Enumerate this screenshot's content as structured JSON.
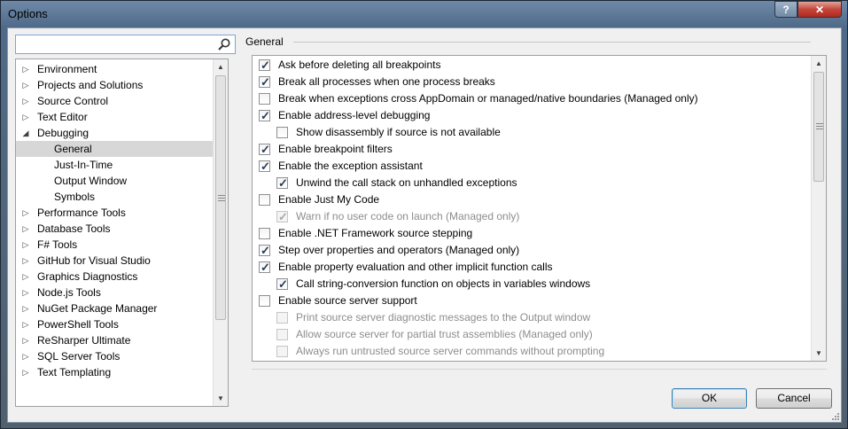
{
  "window": {
    "title": "Options",
    "help_label": "?",
    "close_label": "✕"
  },
  "search": {
    "value": "",
    "placeholder": ""
  },
  "tree": {
    "items": [
      {
        "label": "Environment",
        "expander": "collapsed",
        "level": 0,
        "selected": false
      },
      {
        "label": "Projects and Solutions",
        "expander": "collapsed",
        "level": 0,
        "selected": false
      },
      {
        "label": "Source Control",
        "expander": "collapsed",
        "level": 0,
        "selected": false
      },
      {
        "label": "Text Editor",
        "expander": "collapsed",
        "level": 0,
        "selected": false
      },
      {
        "label": "Debugging",
        "expander": "expanded",
        "level": 0,
        "selected": false
      },
      {
        "label": "General",
        "expander": "none",
        "level": 1,
        "selected": true
      },
      {
        "label": "Just-In-Time",
        "expander": "none",
        "level": 1,
        "selected": false
      },
      {
        "label": "Output Window",
        "expander": "none",
        "level": 1,
        "selected": false
      },
      {
        "label": "Symbols",
        "expander": "none",
        "level": 1,
        "selected": false
      },
      {
        "label": "Performance Tools",
        "expander": "collapsed",
        "level": 0,
        "selected": false
      },
      {
        "label": "Database Tools",
        "expander": "collapsed",
        "level": 0,
        "selected": false
      },
      {
        "label": "F# Tools",
        "expander": "collapsed",
        "level": 0,
        "selected": false
      },
      {
        "label": "GitHub for Visual Studio",
        "expander": "collapsed",
        "level": 0,
        "selected": false
      },
      {
        "label": "Graphics Diagnostics",
        "expander": "collapsed",
        "level": 0,
        "selected": false
      },
      {
        "label": "Node.js Tools",
        "expander": "collapsed",
        "level": 0,
        "selected": false
      },
      {
        "label": "NuGet Package Manager",
        "expander": "collapsed",
        "level": 0,
        "selected": false
      },
      {
        "label": "PowerShell Tools",
        "expander": "collapsed",
        "level": 0,
        "selected": false
      },
      {
        "label": "ReSharper Ultimate",
        "expander": "collapsed",
        "level": 0,
        "selected": false
      },
      {
        "label": "SQL Server Tools",
        "expander": "collapsed",
        "level": 0,
        "selected": false
      },
      {
        "label": "Text Templating",
        "expander": "collapsed",
        "level": 0,
        "selected": false
      }
    ]
  },
  "section": {
    "title": "General"
  },
  "options": [
    {
      "label": "Ask before deleting all breakpoints",
      "checked": true,
      "enabled": true,
      "indent": 0
    },
    {
      "label": "Break all processes when one process breaks",
      "checked": true,
      "enabled": true,
      "indent": 0
    },
    {
      "label": "Break when exceptions cross AppDomain or managed/native boundaries (Managed only)",
      "checked": false,
      "enabled": true,
      "indent": 0
    },
    {
      "label": "Enable address-level debugging",
      "checked": true,
      "enabled": true,
      "indent": 0
    },
    {
      "label": "Show disassembly if source is not available",
      "checked": false,
      "enabled": true,
      "indent": 1
    },
    {
      "label": "Enable breakpoint filters",
      "checked": true,
      "enabled": true,
      "indent": 0
    },
    {
      "label": "Enable the exception assistant",
      "checked": true,
      "enabled": true,
      "indent": 0
    },
    {
      "label": "Unwind the call stack on unhandled exceptions",
      "checked": true,
      "enabled": true,
      "indent": 1
    },
    {
      "label": "Enable Just My Code",
      "checked": false,
      "enabled": true,
      "indent": 0
    },
    {
      "label": "Warn if no user code on launch (Managed only)",
      "checked": true,
      "enabled": false,
      "indent": 1
    },
    {
      "label": "Enable .NET Framework source stepping",
      "checked": false,
      "enabled": true,
      "indent": 0
    },
    {
      "label": "Step over properties and operators (Managed only)",
      "checked": true,
      "enabled": true,
      "indent": 0
    },
    {
      "label": "Enable property evaluation and other implicit function calls",
      "checked": true,
      "enabled": true,
      "indent": 0
    },
    {
      "label": "Call string-conversion function on objects in variables windows",
      "checked": true,
      "enabled": true,
      "indent": 1
    },
    {
      "label": "Enable source server support",
      "checked": false,
      "enabled": true,
      "indent": 0
    },
    {
      "label": "Print source server diagnostic messages to the Output window",
      "checked": false,
      "enabled": false,
      "indent": 1
    },
    {
      "label": "Allow source server for partial trust assemblies (Managed only)",
      "checked": false,
      "enabled": false,
      "indent": 1
    },
    {
      "label": "Always run untrusted source server commands without prompting",
      "checked": false,
      "enabled": false,
      "indent": 1
    }
  ],
  "buttons": {
    "ok_label": "OK",
    "cancel_label": "Cancel"
  }
}
